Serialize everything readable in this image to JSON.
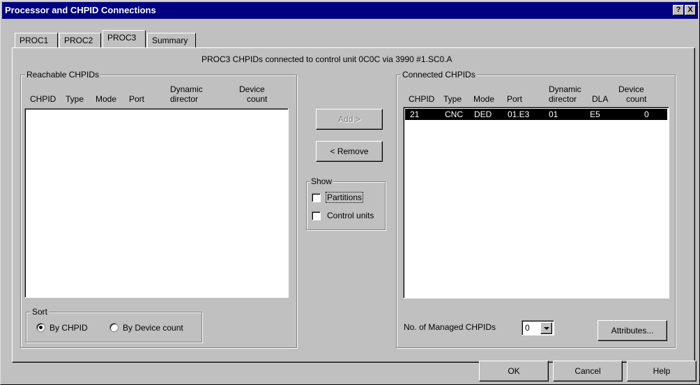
{
  "window": {
    "title": "Processor and CHPID Connections",
    "help_button": "?",
    "close_button": "X"
  },
  "tabs": [
    {
      "label": "PROC1",
      "active": false
    },
    {
      "label": "PROC2",
      "active": false
    },
    {
      "label": "PROC3",
      "active": true
    },
    {
      "label": "Summary",
      "active": false
    }
  ],
  "caption": "PROC3 CHPIDs connected to control unit 0C0C via 3990 #1.SC0.A",
  "reachable": {
    "group_label": "Reachable CHPIDs",
    "columns": [
      "CHPID",
      "Type",
      "Mode",
      "Port",
      "Dynamic",
      "director",
      "Device",
      "count"
    ],
    "rows": []
  },
  "sort": {
    "group_label": "Sort",
    "options": [
      "By CHPID",
      "By Device count"
    ],
    "selected": "By CHPID"
  },
  "buttons": {
    "add": "Add >",
    "remove": "< Remove",
    "attributes": "Attributes...",
    "ok": "OK",
    "cancel": "Cancel",
    "help": "Help"
  },
  "show": {
    "group_label": "Show",
    "partitions": {
      "label": "Partitions",
      "checked": false
    },
    "control_units": {
      "label": "Control units",
      "checked": false
    }
  },
  "connected": {
    "group_label": "Connected CHPIDs",
    "columns": [
      "CHPID",
      "Type",
      "Mode",
      "Port",
      "Dynamic",
      "director",
      "DLA",
      "Device",
      "count"
    ],
    "rows": [
      {
        "chpid": "21",
        "type": "CNC",
        "mode": "DED",
        "port": "01.E3",
        "director": "01",
        "dla": "E5",
        "count": "0",
        "selected": true
      }
    ]
  },
  "managed": {
    "label": "No. of Managed CHPIDs",
    "value": "0"
  },
  "colors": {
    "titlebar": "#000080",
    "face": "#c0c0c0",
    "selection": "#000000"
  }
}
